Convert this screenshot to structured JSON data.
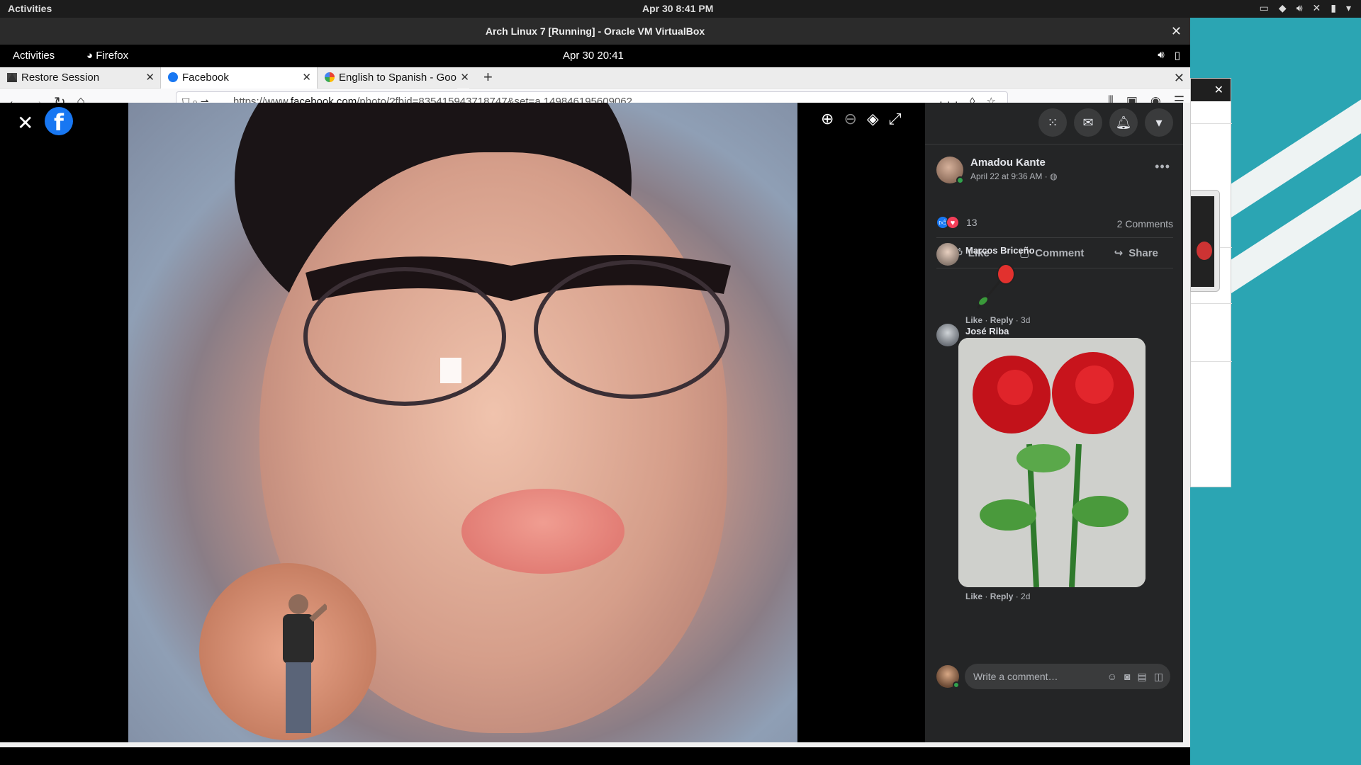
{
  "host": {
    "activities": "Activities",
    "clock": "Apr 30  8:41 PM"
  },
  "vbox": {
    "title": "Arch Linux 7 [Running] - Oracle VM VirtualBox"
  },
  "guest": {
    "activities": "Activities",
    "app": "Firefox",
    "clock": "Apr 30  20:41"
  },
  "tabs": [
    {
      "label": "Restore Session",
      "icon": "warning-icon"
    },
    {
      "label": "Facebook",
      "icon": "facebook-icon"
    },
    {
      "label": "English to Spanish - Goo",
      "icon": "google-icon"
    }
  ],
  "url": {
    "prefix": "https://www.",
    "domain": "facebook.com",
    "path": "/photo/?fbid=835415943718747&set=a.149846195609062"
  },
  "post": {
    "author": "Amadou Kante",
    "time": "April 22 at 9:36 AM · ",
    "reaction_count": "13",
    "comment_count": "2 Comments",
    "actions": {
      "like": "Like",
      "comment": "Comment",
      "share": "Share"
    }
  },
  "comments": [
    {
      "name": "Marcos Briceño",
      "meta_like": "Like",
      "meta_reply": "Reply",
      "meta_time": "3d"
    },
    {
      "name": "José Riba",
      "meta_like": "Like",
      "meta_reply": "Reply",
      "meta_time": "2d"
    }
  ],
  "composer": {
    "placeholder": "Write a comment…"
  },
  "colors": {
    "fb_blue": "#1877f2",
    "panel_bg": "#242526",
    "desktop_teal": "#2ba5b3"
  }
}
